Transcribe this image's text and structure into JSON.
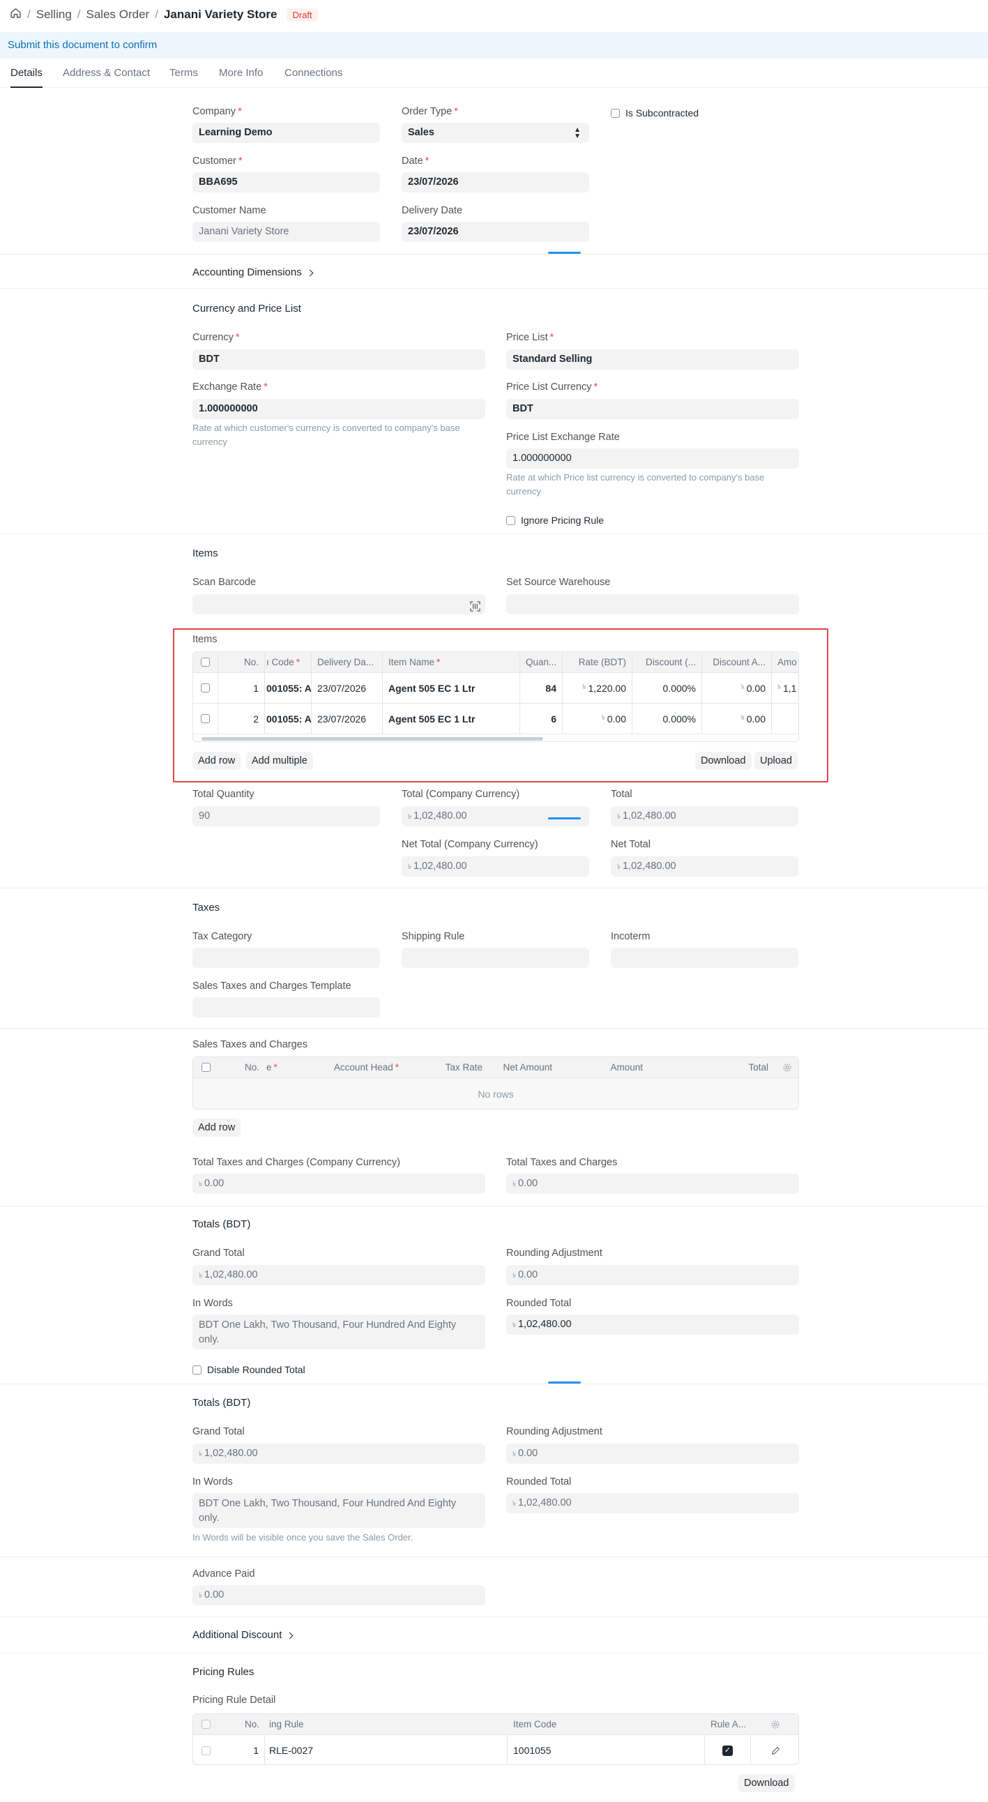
{
  "breadcrumb": {
    "items": [
      "Selling",
      "Sales Order"
    ],
    "current": "Janani Variety Store",
    "status": "Draft"
  },
  "banner": "Submit this document to confirm",
  "tabs": [
    "Details",
    "Address & Contact",
    "Terms",
    "More Info",
    "Connections"
  ],
  "form": {
    "company_label": "Company",
    "company": "Learning Demo",
    "order_type_label": "Order Type",
    "order_type": "Sales",
    "is_subcontracted": "Is Subcontracted",
    "customer_label": "Customer",
    "customer": "BBA695",
    "date_label": "Date",
    "date": "23/07/2026",
    "customer_name_label": "Customer Name",
    "customer_name": "Janani Variety Store",
    "delivery_date_label": "Delivery Date",
    "delivery_date": "23/07/2026"
  },
  "accounting_dimensions": "Accounting Dimensions",
  "currency": {
    "section": "Currency and Price List",
    "currency_label": "Currency",
    "currency": "BDT",
    "price_list_label": "Price List",
    "price_list": "Standard Selling",
    "exchange_rate_label": "Exchange Rate",
    "exchange_rate": "1.000000000",
    "exchange_help": "Rate at which customer's currency is converted to company's base currency",
    "plc_label": "Price List Currency",
    "plc": "BDT",
    "plx_label": "Price List Exchange Rate",
    "plx": "1.000000000",
    "plx_help": "Rate at which Price list currency is converted to company's base currency",
    "ignore_pricing": "Ignore Pricing Rule"
  },
  "items_section": {
    "title": "Items",
    "scan_barcode": "Scan Barcode",
    "source_warehouse": "Set Source Warehouse",
    "table_label": "Items",
    "columns": [
      "No.",
      "ı Code",
      "Delivery Da...",
      "Item Name",
      "Quan...",
      "Rate (BDT)",
      "Discount (...",
      "Discount A...",
      "Amo"
    ],
    "rows": [
      {
        "no": "1",
        "code": "001055: A",
        "date": "23/07/2026",
        "name": "Agent 505 EC 1 Ltr",
        "qty": "84",
        "rate": "1,220.00",
        "disc": "0.000%",
        "disc_amt": "0.00",
        "amt": "1,1"
      },
      {
        "no": "2",
        "code": "001055: A",
        "date": "23/07/2026",
        "name": "Agent 505 EC 1 Ltr",
        "qty": "6",
        "rate": "0.00",
        "disc": "0.000%",
        "disc_amt": "0.00",
        "amt": ""
      }
    ],
    "add_row": "Add row",
    "add_multiple": "Add multiple",
    "download": "Download",
    "upload": "Upload"
  },
  "totals1": {
    "total_qty_label": "Total Quantity",
    "total_qty": "90",
    "total_cc_label": "Total (Company Currency)",
    "total_cc": "1,02,480.00",
    "total_label": "Total",
    "total": "1,02,480.00",
    "net_cc_label": "Net Total (Company Currency)",
    "net_cc": "1,02,480.00",
    "net_label": "Net Total",
    "net": "1,02,480.00"
  },
  "taxes": {
    "title": "Taxes",
    "tax_category": "Tax Category",
    "shipping_rule": "Shipping Rule",
    "incoterm": "Incoterm",
    "template": "Sales Taxes and Charges Template",
    "table_label": "Sales Taxes and Charges",
    "columns": [
      "No.",
      "e",
      "Account Head",
      "Tax Rate",
      "Net Amount",
      "Amount",
      "Total"
    ],
    "no_rows": "No rows",
    "add_row": "Add row",
    "ttc_cc_label": "Total Taxes and Charges (Company Currency)",
    "ttc_cc": "0.00",
    "ttc_label": "Total Taxes and Charges",
    "ttc": "0.00"
  },
  "totals_a": {
    "title": "Totals (BDT)",
    "grand_label": "Grand Total",
    "grand": "1,02,480.00",
    "round_adj_label": "Rounding Adjustment",
    "round_adj": "0.00",
    "words_label": "In Words",
    "words": "BDT One Lakh, Two Thousand, Four Hundred And Eighty only.",
    "rounded_label": "Rounded Total",
    "rounded": "1,02,480.00",
    "disable_rounded": "Disable Rounded Total"
  },
  "totals_b": {
    "title": "Totals (BDT)",
    "grand_label": "Grand Total",
    "grand": "1,02,480.00",
    "round_adj_label": "Rounding Adjustment",
    "round_adj": "0.00",
    "words_label": "In Words",
    "words": "BDT One Lakh, Two Thousand, Four Hundred And Eighty only.",
    "words_help": "In Words will be visible once you save the Sales Order.",
    "rounded_label": "Rounded Total",
    "rounded": "1,02,480.00"
  },
  "advance": {
    "label": "Advance Paid",
    "value": "0.00"
  },
  "additional_discount": "Additional Discount",
  "pricing": {
    "title": "Pricing Rules",
    "table_label": "Pricing Rule Detail",
    "columns": [
      "No.",
      "ing Rule",
      "Item Code",
      "Rule A..."
    ],
    "rows": [
      {
        "no": "1",
        "rule": "RLE-0027",
        "item_code": "1001055"
      }
    ],
    "download": "Download"
  },
  "currency_symbol": "৳",
  "colors": {
    "accent": "#2490ef",
    "draft": "#e03636",
    "highlight": "#e2434b",
    "banner": "#0a6fb3"
  }
}
